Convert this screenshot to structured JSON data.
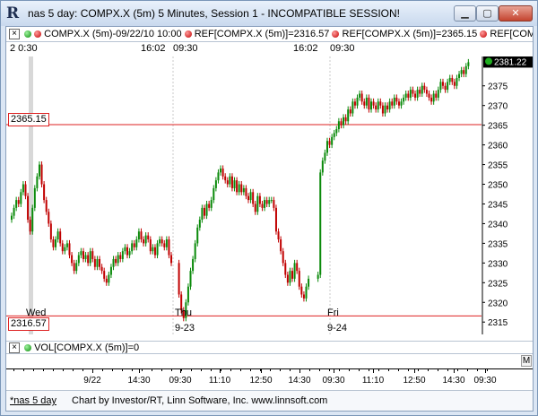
{
  "window": {
    "title": "nas 5 day: COMPX.X (5m) 5 Minutes, Session 1 - INCOMPATIBLE SESSION!",
    "app_icon": "R"
  },
  "legend": {
    "close_glyph": "×",
    "item1": "COMPX.X (5m)-09/22/10 10:00",
    "item2": "REF[COMPX.X (5m)]=2316.57",
    "item3": "REF[COMPX.X (5m)]=2365.15",
    "item4": "REF[COM"
  },
  "session_times": [
    {
      "label": "2  0:30",
      "x": 4
    },
    {
      "label": "16:02",
      "x": 150
    },
    {
      "label": "09:30",
      "x": 186
    },
    {
      "label": "16:02",
      "x": 320
    },
    {
      "label": "09:30",
      "x": 361
    }
  ],
  "price_axis": [
    "2375",
    "2370",
    "2365",
    "2360",
    "2355",
    "2350",
    "2345",
    "2340",
    "2335",
    "2330",
    "2325",
    "2320",
    "2315"
  ],
  "last_price": "2381.22",
  "ref_lines": {
    "upper": "2365.15",
    "lower": "2316.57"
  },
  "day_markers": [
    {
      "day": "Wed",
      "date": "9-22"
    },
    {
      "day": "Thu",
      "date": "9-23"
    },
    {
      "day": "Fri",
      "date": "9-24"
    }
  ],
  "volume": {
    "close_glyph": "×",
    "label": "VOL[COMPX.X (5m)]=0",
    "m_button": "M"
  },
  "x_axis": [
    "9/22",
    "14:30",
    "09:30",
    "11:10",
    "12:50",
    "14:30",
    "09:30",
    "11:10",
    "12:50",
    "14:30",
    "09:30"
  ],
  "status": {
    "tab": "*nas 5 day",
    "credit": "Chart by Investor/RT, Linn Software, Inc. www.linnsoft.com"
  },
  "chart_data": {
    "type": "candlestick",
    "ylim": [
      2313,
      2382
    ],
    "reference_lines": [
      2365.15,
      2316.57
    ],
    "last": 2381.22,
    "closes": [
      2342,
      2344,
      2346,
      2345,
      2348,
      2350,
      2347,
      2341,
      2338,
      2344,
      2349,
      2352,
      2355,
      2350,
      2346,
      2343,
      2340,
      2336,
      2334,
      2336,
      2338,
      2335,
      2333,
      2334,
      2335,
      2332,
      2330,
      2328,
      2330,
      2332,
      2333,
      2331,
      2332,
      2330,
      2333,
      2331,
      2329,
      2331,
      2329,
      2328,
      2326,
      2325,
      2327,
      2329,
      2331,
      2330,
      2332,
      2331,
      2333,
      2334,
      2332,
      2333,
      2335,
      2334,
      2336,
      2338,
      2336,
      2335,
      2337,
      2336,
      2333,
      2334,
      2332,
      2335,
      2336,
      2335,
      2334,
      2336,
      2332,
      2330,
      2322,
      2318,
      2316,
      2320,
      2324,
      2328,
      2331,
      2335,
      2339,
      2341,
      2344,
      2342,
      2345,
      2344,
      2346,
      2349,
      2351,
      2353,
      2354,
      2352,
      2351,
      2350,
      2352,
      2349,
      2351,
      2348,
      2350,
      2348,
      2349,
      2347,
      2346,
      2348,
      2345,
      2343,
      2347,
      2345,
      2344,
      2346,
      2345,
      2346,
      2346,
      2344,
      2338,
      2336,
      2333,
      2330,
      2327,
      2325,
      2328,
      2326,
      2330,
      2328,
      2324,
      2322,
      2321,
      2324,
      2326,
      2327,
      2353,
      2356,
      2358,
      2361,
      2360,
      2362,
      2363,
      2364,
      2366,
      2365,
      2367,
      2366,
      2369,
      2368,
      2371,
      2370,
      2372,
      2373,
      2371,
      2370,
      2372,
      2369,
      2371,
      2370,
      2369,
      2371,
      2370,
      2368,
      2370,
      2369,
      2371,
      2370,
      2372,
      2371,
      2370,
      2371,
      2372,
      2373,
      2372,
      2374,
      2373,
      2372,
      2374,
      2373,
      2375,
      2374,
      2373,
      2372,
      2371,
      2373,
      2372,
      2374,
      2376,
      2375,
      2374,
      2376,
      2377,
      2376,
      2375,
      2377,
      2378,
      2379,
      2378,
      2380,
      2381
    ]
  }
}
